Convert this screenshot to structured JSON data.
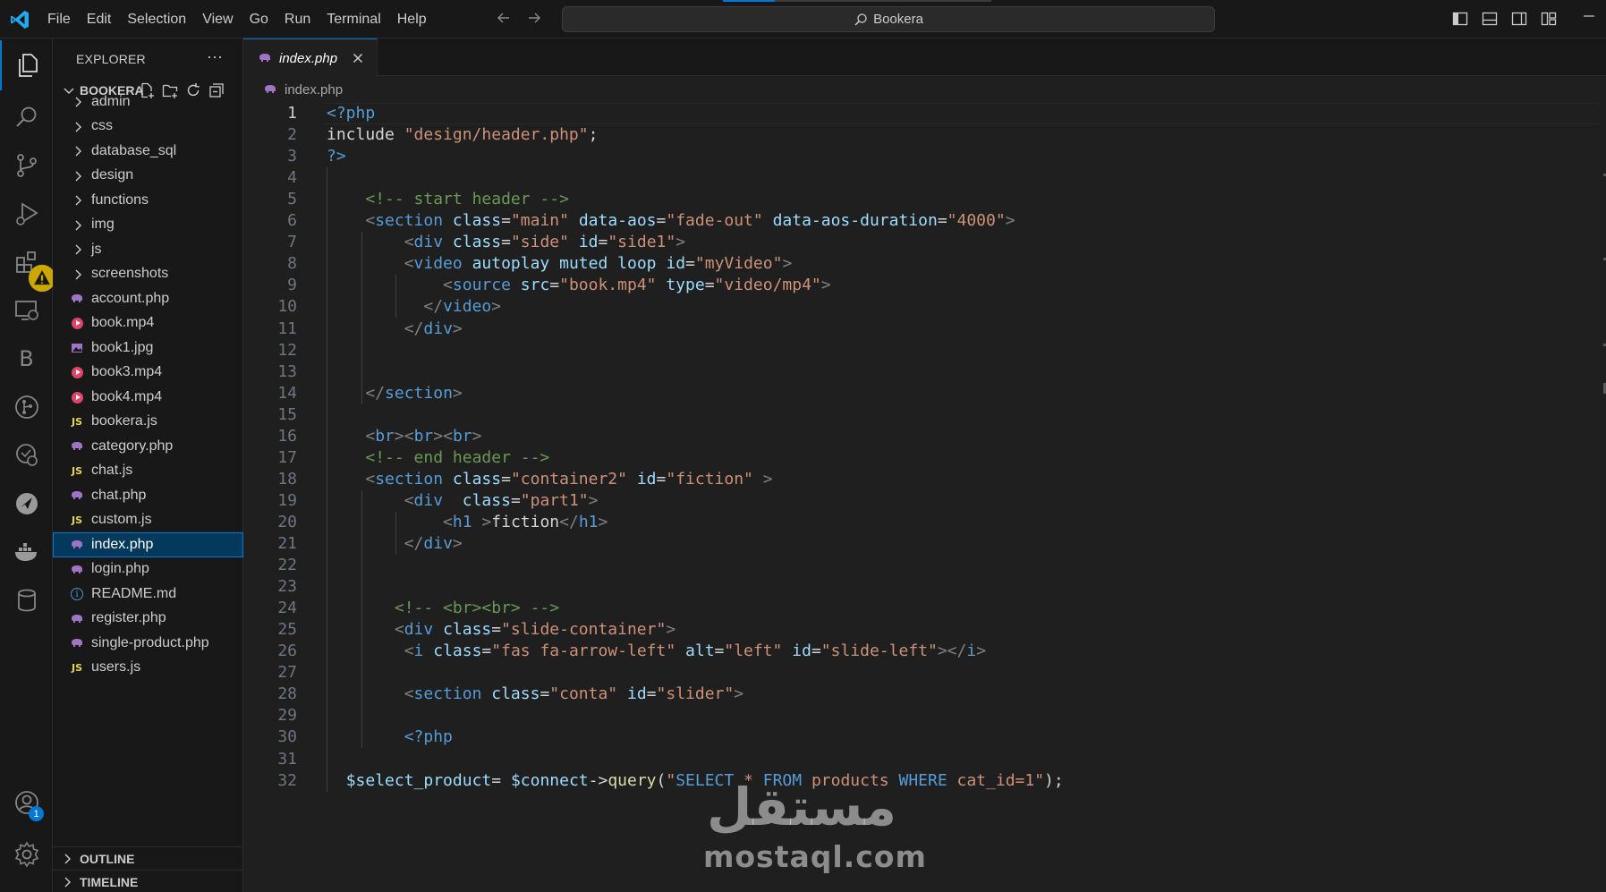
{
  "menu": [
    "File",
    "Edit",
    "Selection",
    "View",
    "Go",
    "Run",
    "Terminal",
    "Help"
  ],
  "search": {
    "text": "Bookera"
  },
  "sidebar": {
    "title": "EXPLORER",
    "more": "···",
    "root": "BOOKERA",
    "folders": [
      "admin",
      "css",
      "database_sql",
      "design",
      "functions",
      "img",
      "js",
      "screenshots"
    ],
    "files": [
      {
        "name": "account.php",
        "icon": "php-elephant-icon"
      },
      {
        "name": "book.mp4",
        "icon": "video-icon"
      },
      {
        "name": "book1.jpg",
        "icon": "image-icon"
      },
      {
        "name": "book3.mp4",
        "icon": "video-icon"
      },
      {
        "name": "book4.mp4",
        "icon": "video-icon"
      },
      {
        "name": "bookera.js",
        "icon": "js-icon"
      },
      {
        "name": "category.php",
        "icon": "php-elephant-icon"
      },
      {
        "name": "chat.js",
        "icon": "js-icon"
      },
      {
        "name": "chat.php",
        "icon": "php-elephant-icon"
      },
      {
        "name": "custom.js",
        "icon": "js-icon"
      },
      {
        "name": "index.php",
        "icon": "php-elephant-icon",
        "selected": true
      },
      {
        "name": "login.php",
        "icon": "php-elephant-icon"
      },
      {
        "name": "README.md",
        "icon": "info-icon"
      },
      {
        "name": "register.php",
        "icon": "php-elephant-icon"
      },
      {
        "name": "single-product.php",
        "icon": "php-elephant-icon"
      },
      {
        "name": "users.js",
        "icon": "js-icon"
      }
    ],
    "outline": "OUTLINE",
    "timeline": "TIMELINE"
  },
  "activity": {
    "accounts_badge": "1",
    "b_label": "B"
  },
  "editor": {
    "tab": "index.php",
    "breadcrumb": "index.php",
    "active_line": 1,
    "lines": [
      [
        [
          "t-tag",
          "<?php"
        ]
      ],
      [
        [
          "t-txt",
          "include "
        ],
        [
          "t-str",
          "\"design/header.php\""
        ],
        [
          "t-txt",
          ";"
        ]
      ],
      [
        [
          "t-tag",
          "?>"
        ]
      ],
      [],
      [
        [
          "t-txt",
          "    "
        ],
        [
          "t-com",
          "<!-- start header -->"
        ]
      ],
      [
        [
          "t-txt",
          "    "
        ],
        [
          "t-punc",
          "<"
        ],
        [
          "t-tag",
          "section"
        ],
        [
          "t-txt",
          " "
        ],
        [
          "t-attr",
          "class"
        ],
        [
          "t-txt",
          "="
        ],
        [
          "t-str",
          "\"main\""
        ],
        [
          "t-txt",
          " "
        ],
        [
          "t-attr",
          "data-aos"
        ],
        [
          "t-txt",
          "="
        ],
        [
          "t-str",
          "\"fade-out\""
        ],
        [
          "t-txt",
          " "
        ],
        [
          "t-attr",
          "data-aos-duration"
        ],
        [
          "t-txt",
          "="
        ],
        [
          "t-str",
          "\"4000\""
        ],
        [
          "t-punc",
          ">"
        ]
      ],
      [
        [
          "t-txt",
          "        "
        ],
        [
          "t-punc",
          "<"
        ],
        [
          "t-tag",
          "div"
        ],
        [
          "t-txt",
          " "
        ],
        [
          "t-attr",
          "class"
        ],
        [
          "t-txt",
          "="
        ],
        [
          "t-str",
          "\"side\""
        ],
        [
          "t-txt",
          " "
        ],
        [
          "t-attr",
          "id"
        ],
        [
          "t-txt",
          "="
        ],
        [
          "t-str",
          "\"side1\""
        ],
        [
          "t-punc",
          ">"
        ]
      ],
      [
        [
          "t-txt",
          "        "
        ],
        [
          "t-punc",
          "<"
        ],
        [
          "t-tag",
          "video"
        ],
        [
          "t-txt",
          " "
        ],
        [
          "t-attr",
          "autoplay"
        ],
        [
          "t-txt",
          " "
        ],
        [
          "t-attr",
          "muted"
        ],
        [
          "t-txt",
          " "
        ],
        [
          "t-attr",
          "loop"
        ],
        [
          "t-txt",
          " "
        ],
        [
          "t-attr",
          "id"
        ],
        [
          "t-txt",
          "="
        ],
        [
          "t-str",
          "\"myVideo\""
        ],
        [
          "t-punc",
          ">"
        ]
      ],
      [
        [
          "t-txt",
          "            "
        ],
        [
          "t-punc",
          "<"
        ],
        [
          "t-tag",
          "source"
        ],
        [
          "t-txt",
          " "
        ],
        [
          "t-attr",
          "src"
        ],
        [
          "t-txt",
          "="
        ],
        [
          "t-str",
          "\"book.mp4\""
        ],
        [
          "t-txt",
          " "
        ],
        [
          "t-attr",
          "type"
        ],
        [
          "t-txt",
          "="
        ],
        [
          "t-str",
          "\"video/mp4\""
        ],
        [
          "t-punc",
          ">"
        ]
      ],
      [
        [
          "t-txt",
          "          "
        ],
        [
          "t-punc",
          "</"
        ],
        [
          "t-tag",
          "video"
        ],
        [
          "t-punc",
          ">"
        ]
      ],
      [
        [
          "t-txt",
          "        "
        ],
        [
          "t-punc",
          "</"
        ],
        [
          "t-tag",
          "div"
        ],
        [
          "t-punc",
          ">"
        ]
      ],
      [],
      [],
      [
        [
          "t-txt",
          "    "
        ],
        [
          "t-punc",
          "</"
        ],
        [
          "t-tag",
          "section"
        ],
        [
          "t-punc",
          ">"
        ]
      ],
      [],
      [
        [
          "t-txt",
          "    "
        ],
        [
          "t-punc",
          "<"
        ],
        [
          "t-tag",
          "br"
        ],
        [
          "t-punc",
          "><"
        ],
        [
          "t-tag",
          "br"
        ],
        [
          "t-punc",
          "><"
        ],
        [
          "t-tag",
          "br"
        ],
        [
          "t-punc",
          ">"
        ]
      ],
      [
        [
          "t-txt",
          "    "
        ],
        [
          "t-com",
          "<!-- end header -->"
        ]
      ],
      [
        [
          "t-txt",
          "    "
        ],
        [
          "t-punc",
          "<"
        ],
        [
          "t-tag",
          "section"
        ],
        [
          "t-txt",
          " "
        ],
        [
          "t-attr",
          "class"
        ],
        [
          "t-txt",
          "="
        ],
        [
          "t-str",
          "\"container2\""
        ],
        [
          "t-txt",
          " "
        ],
        [
          "t-attr",
          "id"
        ],
        [
          "t-txt",
          "="
        ],
        [
          "t-str",
          "\"fiction\""
        ],
        [
          "t-txt",
          " "
        ],
        [
          "t-punc",
          ">"
        ]
      ],
      [
        [
          "t-txt",
          "        "
        ],
        [
          "t-punc",
          "<"
        ],
        [
          "t-tag",
          "div"
        ],
        [
          "t-txt",
          "  "
        ],
        [
          "t-attr",
          "class"
        ],
        [
          "t-txt",
          "="
        ],
        [
          "t-str",
          "\"part1\""
        ],
        [
          "t-punc",
          ">"
        ]
      ],
      [
        [
          "t-txt",
          "            "
        ],
        [
          "t-punc",
          "<"
        ],
        [
          "t-tag",
          "h1"
        ],
        [
          "t-txt",
          " "
        ],
        [
          "t-punc",
          ">"
        ],
        [
          "t-txt",
          "fiction"
        ],
        [
          "t-punc",
          "</"
        ],
        [
          "t-tag",
          "h1"
        ],
        [
          "t-punc",
          ">"
        ]
      ],
      [
        [
          "t-txt",
          "        "
        ],
        [
          "t-punc",
          "</"
        ],
        [
          "t-tag",
          "div"
        ],
        [
          "t-punc",
          ">"
        ]
      ],
      [],
      [],
      [
        [
          "t-txt",
          "       "
        ],
        [
          "t-com",
          "<!-- <br><br> -->"
        ]
      ],
      [
        [
          "t-txt",
          "       "
        ],
        [
          "t-punc",
          "<"
        ],
        [
          "t-tag",
          "div"
        ],
        [
          "t-txt",
          " "
        ],
        [
          "t-attr",
          "class"
        ],
        [
          "t-txt",
          "="
        ],
        [
          "t-str",
          "\"slide-container\""
        ],
        [
          "t-punc",
          ">"
        ]
      ],
      [
        [
          "t-txt",
          "        "
        ],
        [
          "t-punc",
          "<"
        ],
        [
          "t-tag",
          "i"
        ],
        [
          "t-txt",
          " "
        ],
        [
          "t-attr",
          "class"
        ],
        [
          "t-txt",
          "="
        ],
        [
          "t-str",
          "\"fas fa-arrow-left\""
        ],
        [
          "t-txt",
          " "
        ],
        [
          "t-attr",
          "alt"
        ],
        [
          "t-txt",
          "="
        ],
        [
          "t-str",
          "\"left\""
        ],
        [
          "t-txt",
          " "
        ],
        [
          "t-attr",
          "id"
        ],
        [
          "t-txt",
          "="
        ],
        [
          "t-str",
          "\"slide-left\""
        ],
        [
          "t-punc",
          "></"
        ],
        [
          "t-tag",
          "i"
        ],
        [
          "t-punc",
          ">"
        ]
      ],
      [],
      [
        [
          "t-txt",
          "        "
        ],
        [
          "t-punc",
          "<"
        ],
        [
          "t-tag",
          "section"
        ],
        [
          "t-txt",
          " "
        ],
        [
          "t-attr",
          "class"
        ],
        [
          "t-txt",
          "="
        ],
        [
          "t-str",
          "\"conta\""
        ],
        [
          "t-txt",
          " "
        ],
        [
          "t-attr",
          "id"
        ],
        [
          "t-txt",
          "="
        ],
        [
          "t-str",
          "\"slider\""
        ],
        [
          "t-punc",
          ">"
        ]
      ],
      [],
      [
        [
          "t-txt",
          "        "
        ],
        [
          "t-tag",
          "<?php"
        ]
      ],
      [],
      [
        [
          "t-txt",
          "  "
        ],
        [
          "t-var",
          "$select_product"
        ],
        [
          "t-txt",
          "= "
        ],
        [
          "t-var",
          "$connect"
        ],
        [
          "t-txt",
          "->"
        ],
        [
          "t-fn",
          "query"
        ],
        [
          "t-txt",
          "("
        ],
        [
          "t-str",
          "\""
        ],
        [
          "t-kw",
          "SELECT"
        ],
        [
          "t-str",
          " * "
        ],
        [
          "t-kw",
          "FROM"
        ],
        [
          "t-str",
          " products "
        ],
        [
          "t-kw",
          "WHERE"
        ],
        [
          "t-str",
          " cat_id=1\""
        ],
        [
          "t-txt",
          ");"
        ]
      ]
    ]
  },
  "watermark": {
    "arabic": "مستقل",
    "latin": "mostaql.com"
  }
}
